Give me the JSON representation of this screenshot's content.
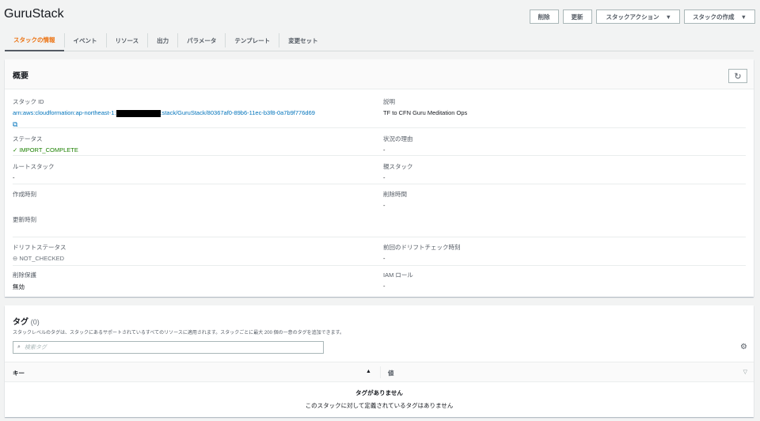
{
  "title": "GuruStack",
  "buttons": {
    "delete": "削除",
    "update": "更新",
    "stack_actions": "スタックアクション",
    "create_stack": "スタックの作成"
  },
  "tabs": [
    "スタックの情報",
    "イベント",
    "リソース",
    "出力",
    "パラメータ",
    "テンプレート",
    "変更セット"
  ],
  "overview": {
    "title": "概要",
    "stack_id_label": "スタック ID",
    "stack_id_prefix": "arn:aws:cloudformation:ap-northeast-1:",
    "stack_id_suffix": ":stack/GuruStack/80367af0-89b6-11ec-b3f8-0a7b9f776d69",
    "description_label": "説明",
    "description": "TF to CFN Guru Meditation Ops",
    "status_label": "ステータス",
    "status": "IMPORT_COMPLETE",
    "status_reason_label": "状況の理由",
    "status_reason": "-",
    "root_stack_label": "ルートスタック",
    "root_stack": "-",
    "parent_stack_label": "親スタック",
    "parent_stack": "-",
    "created_label": "作成時刻",
    "deleted_label": "削除時間",
    "deleted": "-",
    "updated_label": "更新時刻",
    "drift_label": "ドリフトステータス",
    "drift": "NOT_CHECKED",
    "last_drift_label": "前回のドリフトチェック時刻",
    "last_drift": "-",
    "termination_label": "削除保護",
    "termination": "無効",
    "iam_label": "IAM ロール",
    "iam": "-"
  },
  "tags": {
    "title": "タグ",
    "count": "(0)",
    "description": "スタックレベルのタグは、スタックにあるサポートされているすべてのリソースに適用されます。スタックごとに最大 200 個の一意のタグを追加できます。",
    "search_placeholder": "検索タグ",
    "col_key": "キー",
    "col_value": "値",
    "empty_title": "タグがありません",
    "empty_desc": "このスタックに対して定義されているタグはありません"
  }
}
